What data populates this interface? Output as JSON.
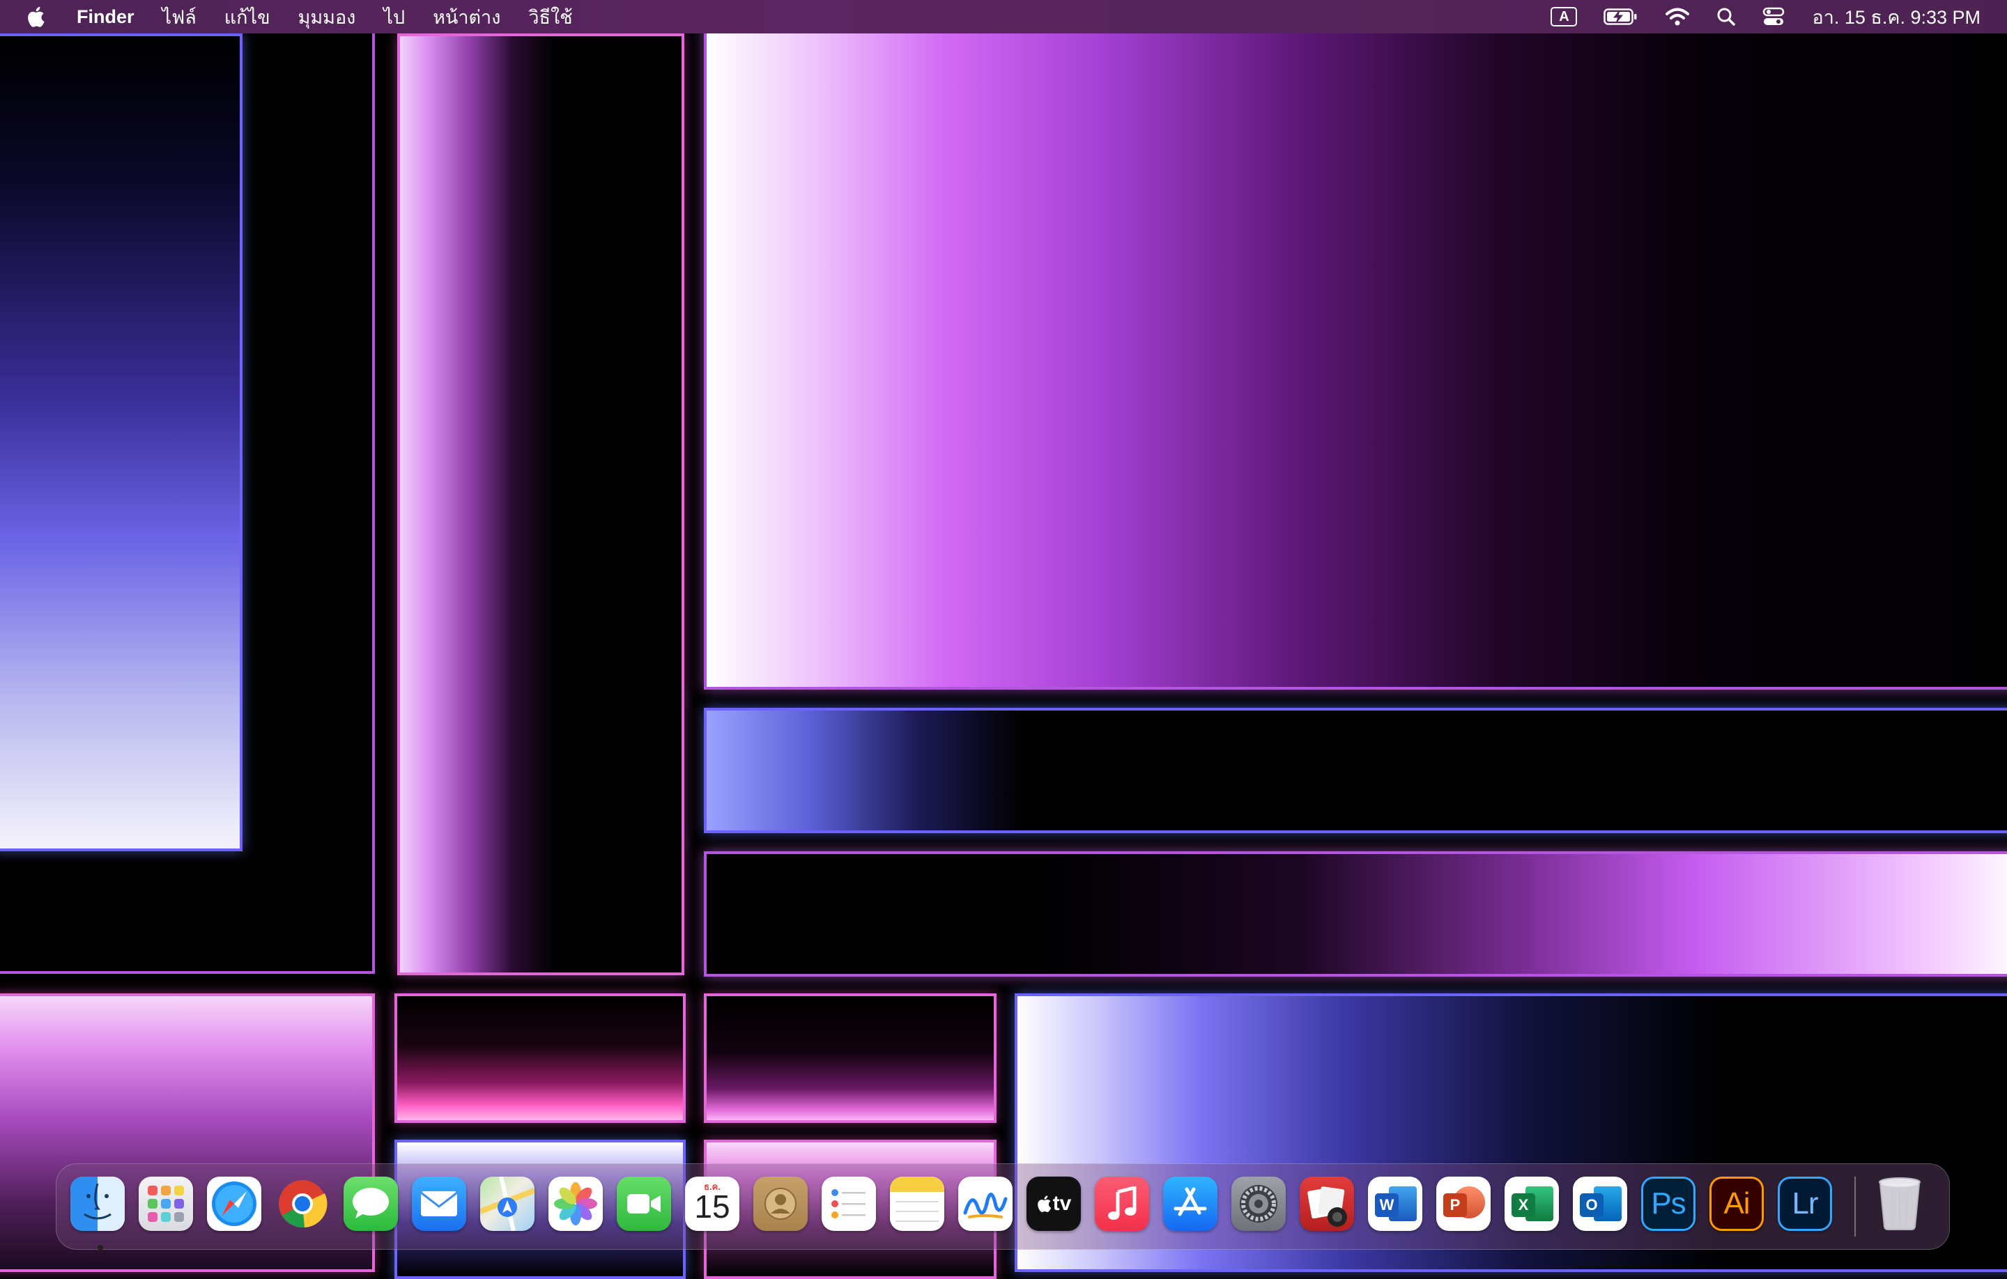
{
  "menubar": {
    "apple_icon": "apple-logo-icon",
    "app_name": "Finder",
    "menus": [
      "ไฟล์",
      "แก้ไข",
      "มุมมอง",
      "ไป",
      "หน้าต่าง",
      "วิธีใช้"
    ],
    "input_source": "A",
    "status_icons": [
      "input-source-icon",
      "battery-charging-icon",
      "wifi-icon",
      "spotlight-search-icon",
      "control-center-icon"
    ],
    "clock": "อา. 15 ธ.ค.  9:33 PM"
  },
  "wallpaper": {
    "colors": {
      "purple": "#c45cf0",
      "blue": "#6a63ff",
      "pink": "#ff4fb0",
      "background": "#000000"
    }
  },
  "dock": {
    "apps": [
      {
        "name": "Finder",
        "icon": "finder-icon",
        "running": true
      },
      {
        "name": "Launchpad",
        "icon": "launchpad-icon"
      },
      {
        "name": "Safari",
        "icon": "safari-icon"
      },
      {
        "name": "Google Chrome",
        "icon": "chrome-icon"
      },
      {
        "name": "Messages",
        "icon": "messages-icon"
      },
      {
        "name": "Mail",
        "icon": "mail-icon"
      },
      {
        "name": "Maps",
        "icon": "maps-icon"
      },
      {
        "name": "Photos",
        "icon": "photos-icon"
      },
      {
        "name": "FaceTime",
        "icon": "facetime-icon"
      },
      {
        "name": "Calendar",
        "icon": "calendar-icon",
        "month": "ธ.ค.",
        "day": "15"
      },
      {
        "name": "Contacts",
        "icon": "contacts-icon"
      },
      {
        "name": "Reminders",
        "icon": "reminders-icon"
      },
      {
        "name": "Notes",
        "icon": "notes-icon"
      },
      {
        "name": "Freeform",
        "icon": "freeform-icon"
      },
      {
        "name": "Apple TV",
        "icon": "apple-tv-icon",
        "label": "tv"
      },
      {
        "name": "Music",
        "icon": "music-icon"
      },
      {
        "name": "App Store",
        "icon": "app-store-icon"
      },
      {
        "name": "System Settings",
        "icon": "system-settings-icon"
      },
      {
        "name": "Photo Booth",
        "icon": "photo-booth-icon"
      },
      {
        "name": "Microsoft Word",
        "icon": "word-icon",
        "label": "W"
      },
      {
        "name": "Microsoft PowerPoint",
        "icon": "powerpoint-icon",
        "label": "P"
      },
      {
        "name": "Microsoft Excel",
        "icon": "excel-icon",
        "label": "X"
      },
      {
        "name": "Microsoft Outlook",
        "icon": "outlook-icon",
        "label": "O"
      },
      {
        "name": "Adobe Photoshop",
        "icon": "photoshop-icon",
        "label": "Ps"
      },
      {
        "name": "Adobe Illustrator",
        "icon": "illustrator-icon",
        "label": "Ai"
      },
      {
        "name": "Adobe Lightroom",
        "icon": "lightroom-icon",
        "label": "Lr"
      }
    ],
    "trash": {
      "name": "Trash",
      "icon": "trash-icon"
    }
  }
}
